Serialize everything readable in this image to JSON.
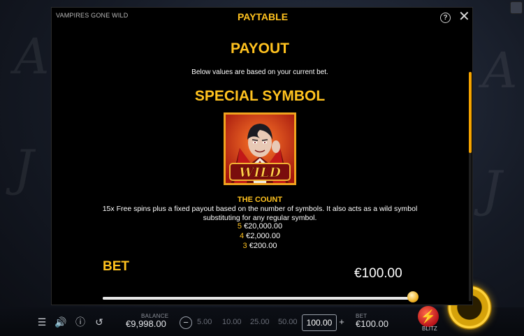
{
  "game": {
    "name": "VAMPIRES GONE WILD"
  },
  "modal": {
    "title": "PAYTABLE",
    "payout_heading": "PAYOUT",
    "payout_note": "Below values are based on your current bet.",
    "special_heading": "SPECIAL SYMBOL",
    "symbol": {
      "name": "THE COUNT",
      "badge": "WILD",
      "description": "15x Free spins plus a fixed payout based on the number of symbols. It also acts as a wild symbol substituting for any regular symbol.",
      "payouts": [
        {
          "count": "5",
          "amount": "€20,000.00"
        },
        {
          "count": "4",
          "amount": "€2,000.00"
        },
        {
          "count": "3",
          "amount": "€200.00"
        }
      ]
    },
    "bet_label": "BET",
    "bet_value": "€100.00",
    "bet_slider_fraction": 1.0,
    "scroll_fraction": 0.15
  },
  "bottom_bar": {
    "balance_label": "BALANCE",
    "balance_value": "€9,998.00",
    "bet_options": [
      "5.00",
      "10.00",
      "25.00",
      "50.00"
    ],
    "current_bet": "100.00",
    "bet_label": "BET",
    "bet_value": "€100.00",
    "blitz_label": "BLITZ"
  },
  "icons": {
    "help": "help-circle-icon",
    "close": "close-icon",
    "menu": "menu-icon",
    "sound": "speaker-icon",
    "info": "info-icon",
    "history": "history-icon",
    "minus": "minus-icon",
    "plus": "plus-icon",
    "blitz": "lightning-icon",
    "spin": "spin-button"
  },
  "colors": {
    "accent": "#ffc21f",
    "scroll": "#f5a300",
    "modal_bg": "#000000"
  }
}
